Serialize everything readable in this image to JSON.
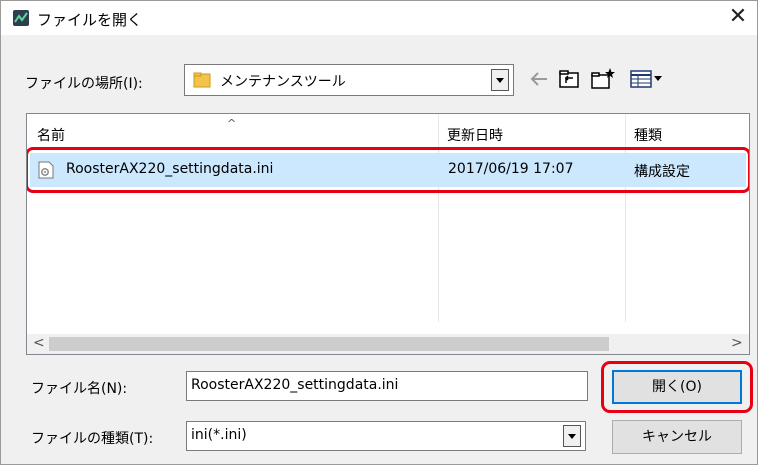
{
  "window": {
    "title": "ファイルを開く",
    "close_glyph": "✕"
  },
  "lookin": {
    "label": "ファイルの場所(I):",
    "value": "メンテナンスツール"
  },
  "toolbar": {
    "icons": [
      "back-icon",
      "up-folder-icon",
      "new-folder-icon",
      "view-menu-icon"
    ]
  },
  "list": {
    "columns": {
      "name": "名前",
      "date": "更新日時",
      "type": "種類"
    },
    "sort_glyph": "^",
    "rows": [
      {
        "name": "RoosterAX220_settingdata.ini",
        "date": "2017/06/19 17:07",
        "type": "構成設定"
      }
    ],
    "scroll_left": "<",
    "scroll_right": ">"
  },
  "filename": {
    "label": "ファイル名(N):",
    "value": "RoosterAX220_settingdata.ini"
  },
  "filetype": {
    "label": "ファイルの種類(T):",
    "value": "ini(*.ini)"
  },
  "buttons": {
    "open": "開く(O)",
    "cancel": "キャンセル"
  },
  "colors": {
    "selection": "#cce8ff",
    "highlight": "#e60012",
    "accent": "#0078d7"
  }
}
